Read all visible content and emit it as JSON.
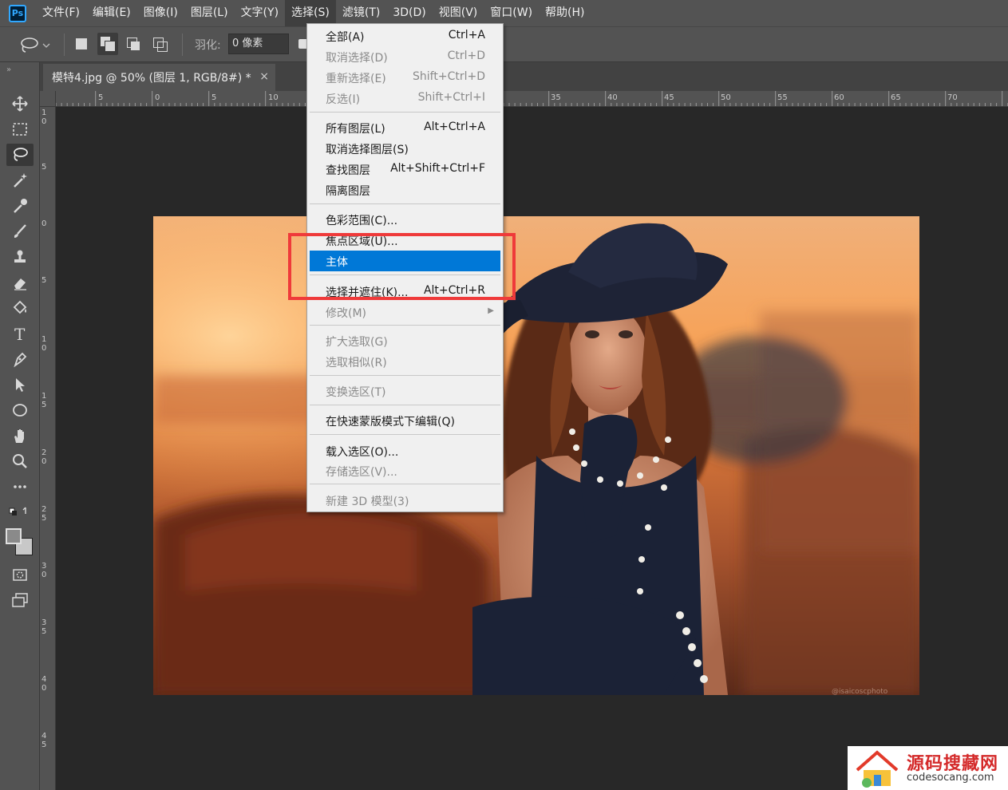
{
  "app": {
    "logo": "Ps"
  },
  "menubar": {
    "items": [
      "文件(F)",
      "编辑(E)",
      "图像(I)",
      "图层(L)",
      "文字(Y)",
      "选择(S)",
      "滤镜(T)",
      "3D(D)",
      "视图(V)",
      "窗口(W)",
      "帮助(H)"
    ],
    "active": "选择(S)"
  },
  "options_bar": {
    "tool_icon": "lasso-icon",
    "feather_label": "羽化:",
    "feather_value": "0 像素"
  },
  "document": {
    "tab_title": "模特4.jpg @ 50% (图层 1, RGB/8#) *",
    "close_glyph": "×"
  },
  "rulers": {
    "top_labels": [
      "5",
      "0",
      "5",
      "10",
      "35",
      "40",
      "45",
      "50",
      "55",
      "60",
      "65",
      "70"
    ],
    "left_labels": [
      "1 0",
      "5",
      "0",
      "5",
      "1 0",
      "1 5",
      "2 0",
      "2 5",
      "3 0",
      "3 5",
      "4 0",
      "4 5"
    ]
  },
  "select_menu": {
    "items": [
      {
        "label": "全部(A)",
        "shortcut": "Ctrl+A",
        "disabled": false
      },
      {
        "label": "取消选择(D)",
        "shortcut": "Ctrl+D",
        "disabled": true
      },
      {
        "label": "重新选择(E)",
        "shortcut": "Shift+Ctrl+D",
        "disabled": true
      },
      {
        "label": "反选(I)",
        "shortcut": "Shift+Ctrl+I",
        "disabled": true
      },
      {
        "label": "所有图层(L)",
        "shortcut": "Alt+Ctrl+A",
        "disabled": false
      },
      {
        "label": "取消选择图层(S)",
        "shortcut": "",
        "disabled": false
      },
      {
        "label": "查找图层",
        "shortcut": "Alt+Shift+Ctrl+F",
        "disabled": false
      },
      {
        "label": "隔离图层",
        "shortcut": "",
        "disabled": false
      },
      {
        "label": "色彩范围(C)...",
        "shortcut": "",
        "disabled": false
      },
      {
        "label": "焦点区域(U)...",
        "shortcut": "",
        "disabled": false
      },
      {
        "label": "主体",
        "shortcut": "",
        "disabled": false,
        "highlighted": true
      },
      {
        "label": "选择并遮住(K)...",
        "shortcut": "Alt+Ctrl+R",
        "disabled": false
      },
      {
        "label": "修改(M)",
        "shortcut": "",
        "disabled": true,
        "submenu": true
      },
      {
        "label": "扩大选取(G)",
        "shortcut": "",
        "disabled": true
      },
      {
        "label": "选取相似(R)",
        "shortcut": "",
        "disabled": true
      },
      {
        "label": "变换选区(T)",
        "shortcut": "",
        "disabled": true
      },
      {
        "label": "在快速蒙版模式下编辑(Q)",
        "shortcut": "",
        "disabled": false
      },
      {
        "label": "载入选区(O)...",
        "shortcut": "",
        "disabled": false
      },
      {
        "label": "存储选区(V)...",
        "shortcut": "",
        "disabled": true
      },
      {
        "label": "新建 3D 模型(3)",
        "shortcut": "",
        "disabled": true
      }
    ]
  },
  "watermark": {
    "title": "源码搜藏网",
    "url": "codesocang.com"
  },
  "colors": {
    "highlight": "#0078d7",
    "annotation_box": "#ef3a3a"
  }
}
